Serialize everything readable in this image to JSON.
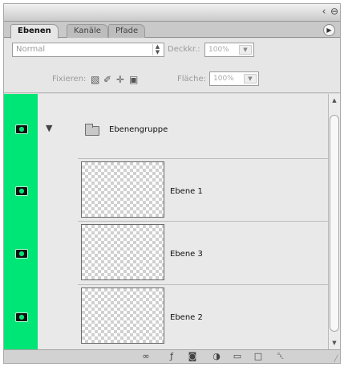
{
  "tabs": [
    {
      "label": "Ebenen",
      "active": true
    },
    {
      "label": "Kanäle",
      "active": false
    },
    {
      "label": "Pfade",
      "active": false
    }
  ],
  "titlebar": {
    "icons": [
      "collapse-icon",
      "close-icon"
    ]
  },
  "blend": {
    "mode": "Normal"
  },
  "opacity": {
    "label": "Deckkr.:",
    "value": "100%"
  },
  "lock": {
    "label": "Fixieren:",
    "icons": [
      "lock-transparency-icon",
      "lock-paint-icon",
      "lock-move-icon",
      "lock-all-icon"
    ]
  },
  "fill": {
    "label": "Fläche:",
    "value": "100%"
  },
  "layers": [
    {
      "name": "Ebenengruppe",
      "type": "group",
      "visible": true,
      "expanded": true
    },
    {
      "name": "Ebene 1",
      "type": "layer",
      "visible": true
    },
    {
      "name": "Ebene 3",
      "type": "layer",
      "visible": true
    },
    {
      "name": "Ebene 2",
      "type": "layer",
      "visible": true
    }
  ],
  "colors": {
    "visibility_strip": "#00e676",
    "panel_bg": "#dcdcdc"
  },
  "footer_icons": [
    "link-layers-icon",
    "layer-style-icon",
    "layer-mask-icon",
    "adjustment-layer-icon",
    "new-group-icon",
    "new-layer-icon",
    "delete-layer-icon"
  ]
}
